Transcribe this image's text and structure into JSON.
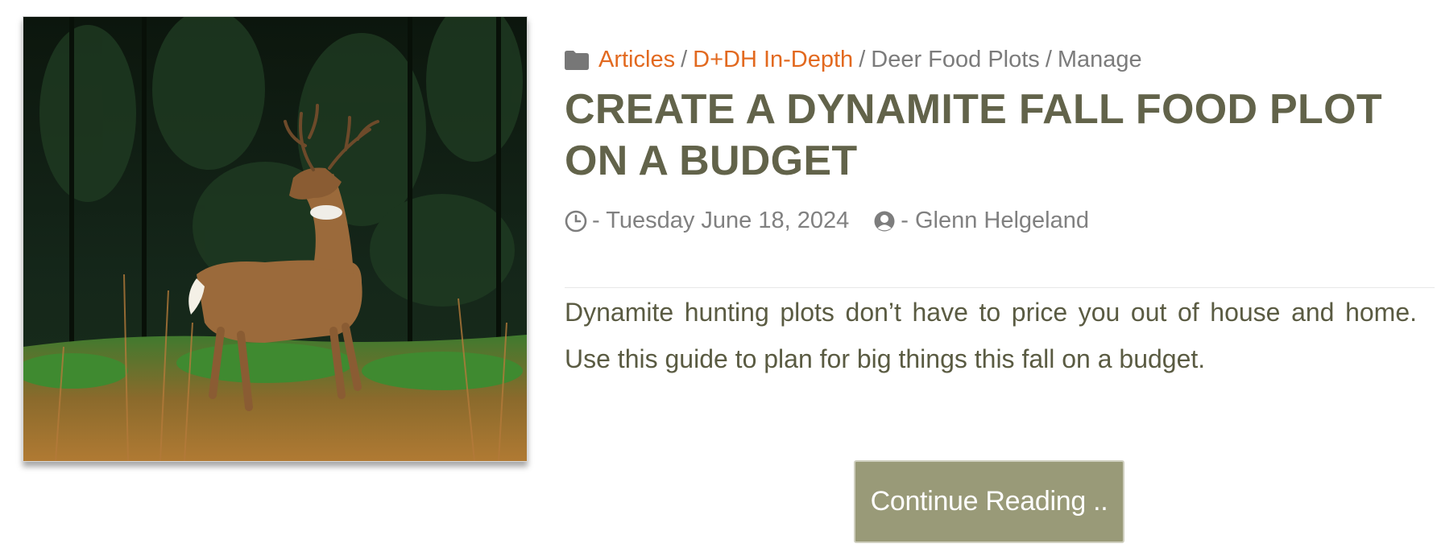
{
  "article": {
    "image": {
      "subject": "Whitetail buck standing in a fall food plot",
      "alt": "deer-photo"
    },
    "breadcrumb": {
      "icon": "folder-icon",
      "items": [
        "Articles",
        "D+DH In-Depth",
        "Deer Food Plots",
        "Manage"
      ],
      "separator": "/"
    },
    "title": "CREATE A DYNAMITE FALL FOOD PLOT ON A BUDGET",
    "date_prefix": "- Tuesday June 18, 2024",
    "author_prefix": "- Glenn Helgeland",
    "excerpt": "Dynamite hunting plots don’t have to price you out of house and home. Use this guide to plan for big things this fall on a budget.",
    "continue_label": "Continue Reading .."
  },
  "colors": {
    "accent_link": "#e2691f",
    "title": "#62634a",
    "button_bg": "#999a78",
    "meta_text": "#808080"
  }
}
